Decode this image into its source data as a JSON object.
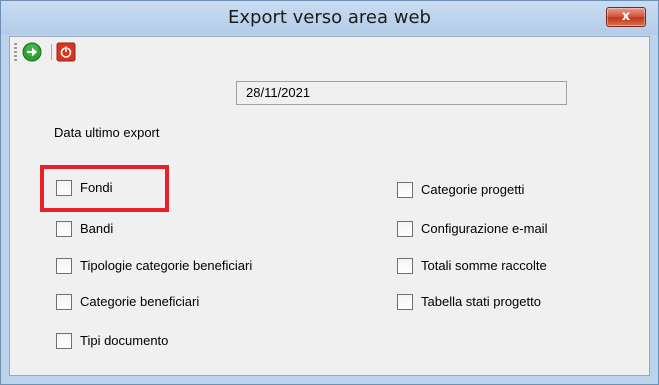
{
  "window": {
    "title": "Export verso area web",
    "close_label": "x"
  },
  "toolbar": {
    "icons": [
      "go-forward-icon",
      "power-icon"
    ],
    "colors": {
      "go": "#2fa033",
      "power": "#d9341f"
    }
  },
  "export_date": {
    "label": "Data ultimo export",
    "value": "28/11/2021"
  },
  "left_options": [
    {
      "label": "Fondi",
      "checked": false
    },
    {
      "label": "Bandi",
      "checked": false
    },
    {
      "label": "Tipologie categorie beneficiari",
      "checked": false
    },
    {
      "label": "Categorie beneficiari",
      "checked": false
    },
    {
      "label": "Tipi documento",
      "checked": false
    }
  ],
  "right_options": [
    {
      "label": "Categorie progetti",
      "checked": false
    },
    {
      "label": "Configurazione e-mail",
      "checked": false
    },
    {
      "label": "Totali somme raccolte",
      "checked": false
    },
    {
      "label": "Tabella stati progetto",
      "checked": false
    }
  ],
  "highlight_color": "#e8202a"
}
